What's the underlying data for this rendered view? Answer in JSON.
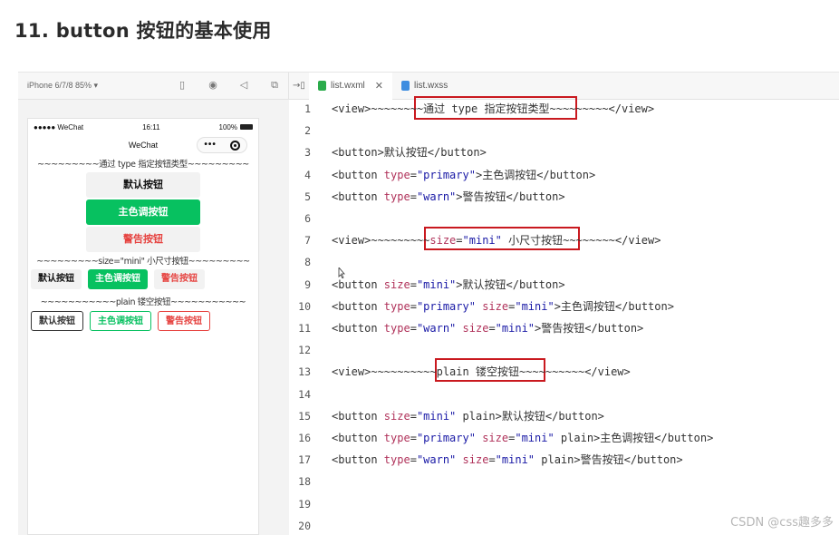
{
  "heading": "11. button 按钮的基本使用",
  "simulator": {
    "device_label": "iPhone 6/7/8 85% ▾",
    "status": {
      "carrier": "●●●●● WeChat",
      "time": "16:11",
      "battery": "100%"
    },
    "nav_title": "WeChat",
    "section1": "~~~~~~~~~通过 type 指定按钮类型~~~~~~~~~",
    "buttons_block": [
      {
        "label": "默认按钮",
        "kind": "default"
      },
      {
        "label": "主色调按钮",
        "kind": "primary"
      },
      {
        "label": "警告按钮",
        "kind": "warn"
      }
    ],
    "section2": "~~~~~~~~~size=\"mini\" 小尺寸按钮~~~~~~~~~",
    "buttons_mini": [
      {
        "label": "默认按钮",
        "kind": "default"
      },
      {
        "label": "主色调按钮",
        "kind": "primary"
      },
      {
        "label": "警告按钮",
        "kind": "warn"
      }
    ],
    "section3": "~~~~~~~~~~~plain 镂空按钮~~~~~~~~~~~",
    "buttons_plain": [
      {
        "label": "默认按钮",
        "kind": "default"
      },
      {
        "label": "主色调按钮",
        "kind": "primary"
      },
      {
        "label": "警告按钮",
        "kind": "warn"
      }
    ]
  },
  "editor": {
    "tabs": [
      {
        "label": "list.wxml",
        "active": true
      },
      {
        "label": "list.wxss",
        "active": false
      }
    ],
    "lines": [
      {
        "n": "1",
        "code": "<view>~~~~~~~~通过 type 指定按钮类型~~~~~~~~~</view>"
      },
      {
        "n": "2",
        "code": ""
      },
      {
        "n": "3",
        "code": "<button>默认按钮</button>"
      },
      {
        "n": "4",
        "code": "<button type=\"primary\">主色调按钮</button>"
      },
      {
        "n": "5",
        "code": "<button type=\"warn\">警告按钮</button>"
      },
      {
        "n": "6",
        "code": ""
      },
      {
        "n": "7",
        "code": "<view>~~~~~~~~~size=\"mini\" 小尺寸按钮~~~~~~~~</view>"
      },
      {
        "n": "8",
        "code": ""
      },
      {
        "n": "9",
        "code": "<button size=\"mini\">默认按钮</button>"
      },
      {
        "n": "10",
        "code": "<button type=\"primary\" size=\"mini\">主色调按钮</button>"
      },
      {
        "n": "11",
        "code": "<button type=\"warn\" size=\"mini\">警告按钮</button>"
      },
      {
        "n": "12",
        "code": ""
      },
      {
        "n": "13",
        "code": "<view>~~~~~~~~~~plain 镂空按钮~~~~~~~~~~</view>"
      },
      {
        "n": "14",
        "code": ""
      },
      {
        "n": "15",
        "code": "<button size=\"mini\" plain>默认按钮</button>"
      },
      {
        "n": "16",
        "code": "<button type=\"primary\" size=\"mini\" plain>主色调按钮</button>"
      },
      {
        "n": "17",
        "code": "<button type=\"warn\" size=\"mini\" plain>警告按钮</button>"
      },
      {
        "n": "18",
        "code": ""
      },
      {
        "n": "19",
        "code": ""
      },
      {
        "n": "20",
        "code": ""
      }
    ]
  },
  "watermark": "CSDN @css趣多多",
  "colors": {
    "primary": "#07c160",
    "warn": "#e64340",
    "highlight": "#c9191f"
  }
}
